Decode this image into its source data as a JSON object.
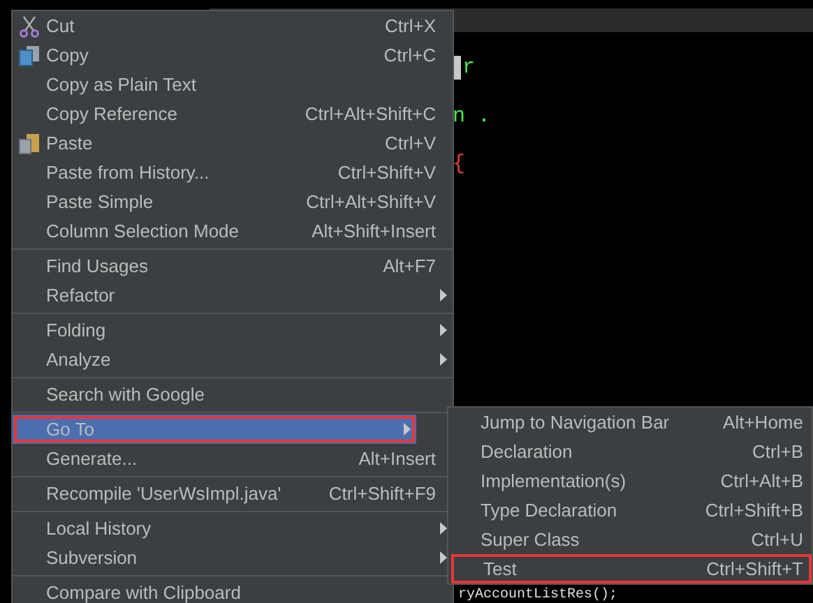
{
  "editor": {
    "fragments": [
      {
        "text": "r",
        "color": "#4ee44e"
      },
      {
        "text": "n .",
        "color": "#4ee44e"
      },
      {
        "text": "{",
        "color": "#e0453a"
      }
    ],
    "bottom_line": "ryAccountListRes();"
  },
  "context_menu": {
    "groups": [
      [
        {
          "label": "Cut",
          "shortcut": "Ctrl+X",
          "submenu": false,
          "selected": false
        },
        {
          "label": "Copy",
          "shortcut": "Ctrl+C",
          "submenu": false,
          "selected": false
        },
        {
          "label": "Copy as Plain Text",
          "submenu": false,
          "selected": false
        },
        {
          "label": "Copy Reference",
          "shortcut": "Ctrl+Alt+Shift+C",
          "submenu": false,
          "selected": false
        },
        {
          "label": "Paste",
          "shortcut": "Ctrl+V",
          "submenu": false,
          "selected": false
        },
        {
          "label": "Paste from History...",
          "shortcut": "Ctrl+Shift+V",
          "submenu": false,
          "selected": false
        },
        {
          "label": "Paste Simple",
          "shortcut": "Ctrl+Alt+Shift+V",
          "submenu": false,
          "selected": false
        },
        {
          "label": "Column Selection Mode",
          "shortcut": "Alt+Shift+Insert",
          "submenu": false,
          "selected": false
        }
      ],
      [
        {
          "label": "Find Usages",
          "shortcut": "Alt+F7",
          "submenu": false,
          "selected": false
        },
        {
          "label": "Refactor",
          "submenu": true,
          "selected": false
        }
      ],
      [
        {
          "label": "Folding",
          "submenu": true,
          "selected": false
        },
        {
          "label": "Analyze",
          "submenu": true,
          "selected": false
        }
      ],
      [
        {
          "label": "Search with Google",
          "submenu": false,
          "selected": false
        }
      ],
      [
        {
          "label": "Go To",
          "submenu": true,
          "selected": true
        },
        {
          "label": "Generate...",
          "shortcut": "Alt+Insert",
          "submenu": false,
          "selected": false
        }
      ],
      [
        {
          "label": "Recompile 'UserWsImpl.java'",
          "shortcut": "Ctrl+Shift+F9",
          "submenu": false,
          "selected": false
        }
      ],
      [
        {
          "label": "Local History",
          "submenu": true,
          "selected": false
        },
        {
          "label": "Subversion",
          "submenu": true,
          "selected": false
        }
      ],
      [
        {
          "label": "Compare with Clipboard",
          "submenu": false,
          "selected": false
        }
      ]
    ]
  },
  "submenu": {
    "items": [
      {
        "label": "Jump to Navigation Bar",
        "shortcut": "Alt+Home",
        "highlighted": false
      },
      {
        "label": "Declaration",
        "shortcut": "Ctrl+B",
        "highlighted": false
      },
      {
        "label": "Implementation(s)",
        "shortcut": "Ctrl+Alt+B",
        "highlighted": false
      },
      {
        "label": "Type Declaration",
        "shortcut": "Ctrl+Shift+B",
        "highlighted": false
      },
      {
        "label": "Super Class",
        "shortcut": "Ctrl+U",
        "highlighted": false
      },
      {
        "label": "Test",
        "shortcut": "Ctrl+Shift+T",
        "highlighted": true
      }
    ]
  }
}
